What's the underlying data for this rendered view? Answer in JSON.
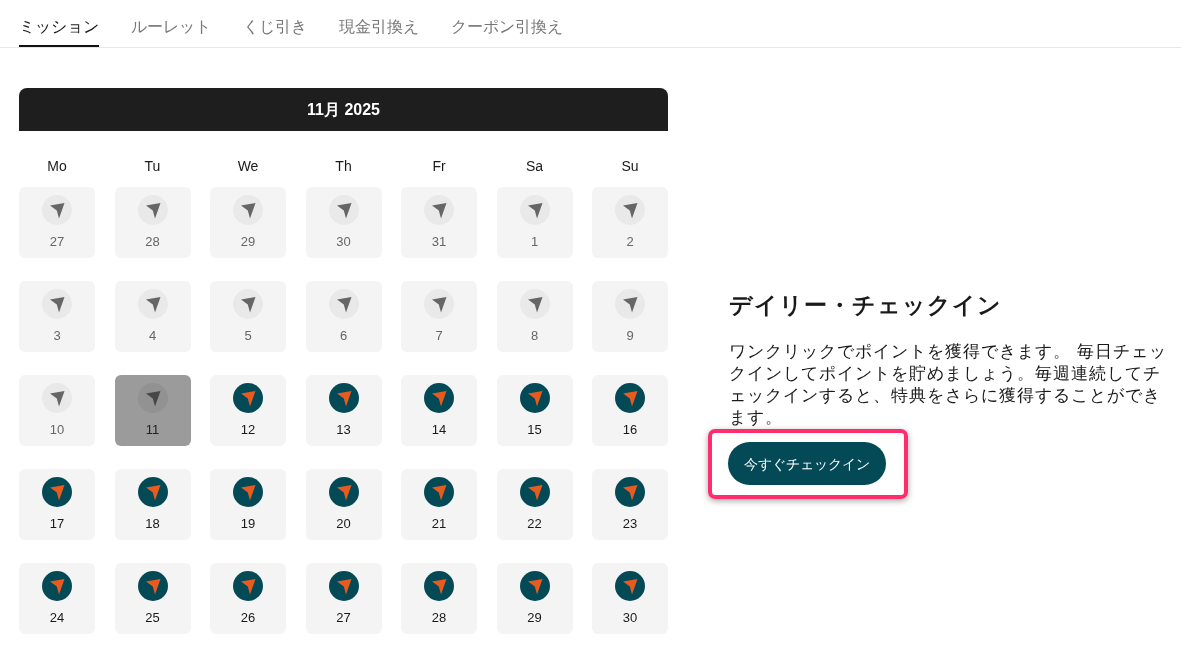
{
  "tabs": [
    {
      "label": "ミッション",
      "selected": true
    },
    {
      "label": "ルーレット",
      "selected": false
    },
    {
      "label": "くじ引き",
      "selected": false
    },
    {
      "label": "現金引換え",
      "selected": false
    },
    {
      "label": "クーポン引換え",
      "selected": false
    }
  ],
  "calendar": {
    "title": "11月 2025",
    "weekdays": [
      "Mo",
      "Tu",
      "We",
      "Th",
      "Fr",
      "Sa",
      "Su"
    ],
    "days": [
      {
        "label": "27",
        "kind": "past"
      },
      {
        "label": "28",
        "kind": "past"
      },
      {
        "label": "29",
        "kind": "past"
      },
      {
        "label": "30",
        "kind": "past"
      },
      {
        "label": "31",
        "kind": "past"
      },
      {
        "label": "1",
        "kind": "past"
      },
      {
        "label": "2",
        "kind": "past"
      },
      {
        "label": "3",
        "kind": "past"
      },
      {
        "label": "4",
        "kind": "past"
      },
      {
        "label": "5",
        "kind": "past"
      },
      {
        "label": "6",
        "kind": "past"
      },
      {
        "label": "7",
        "kind": "past"
      },
      {
        "label": "8",
        "kind": "past"
      },
      {
        "label": "9",
        "kind": "past"
      },
      {
        "label": "10",
        "kind": "past"
      },
      {
        "label": "11",
        "kind": "today"
      },
      {
        "label": "12",
        "kind": "upcoming"
      },
      {
        "label": "13",
        "kind": "upcoming"
      },
      {
        "label": "14",
        "kind": "upcoming"
      },
      {
        "label": "15",
        "kind": "upcoming"
      },
      {
        "label": "16",
        "kind": "upcoming"
      },
      {
        "label": "17",
        "kind": "upcoming"
      },
      {
        "label": "18",
        "kind": "upcoming"
      },
      {
        "label": "19",
        "kind": "upcoming"
      },
      {
        "label": "20",
        "kind": "upcoming"
      },
      {
        "label": "21",
        "kind": "upcoming"
      },
      {
        "label": "22",
        "kind": "upcoming"
      },
      {
        "label": "23",
        "kind": "upcoming"
      },
      {
        "label": "24",
        "kind": "upcoming"
      },
      {
        "label": "25",
        "kind": "upcoming"
      },
      {
        "label": "26",
        "kind": "upcoming"
      },
      {
        "label": "27",
        "kind": "upcoming"
      },
      {
        "label": "28",
        "kind": "upcoming"
      },
      {
        "label": "29",
        "kind": "upcoming"
      },
      {
        "label": "30",
        "kind": "upcoming"
      }
    ]
  },
  "daily_checkin": {
    "title": "デイリー・チェックイン",
    "description": "ワンクリックでポイントを獲得できます。 毎日チェックインしてポイントを貯めましょう。毎週連続してチェックインすると、特典をさらに獲得することができます。",
    "button": {
      "label": "今すぐチェックイン",
      "highlighted": true
    }
  }
}
